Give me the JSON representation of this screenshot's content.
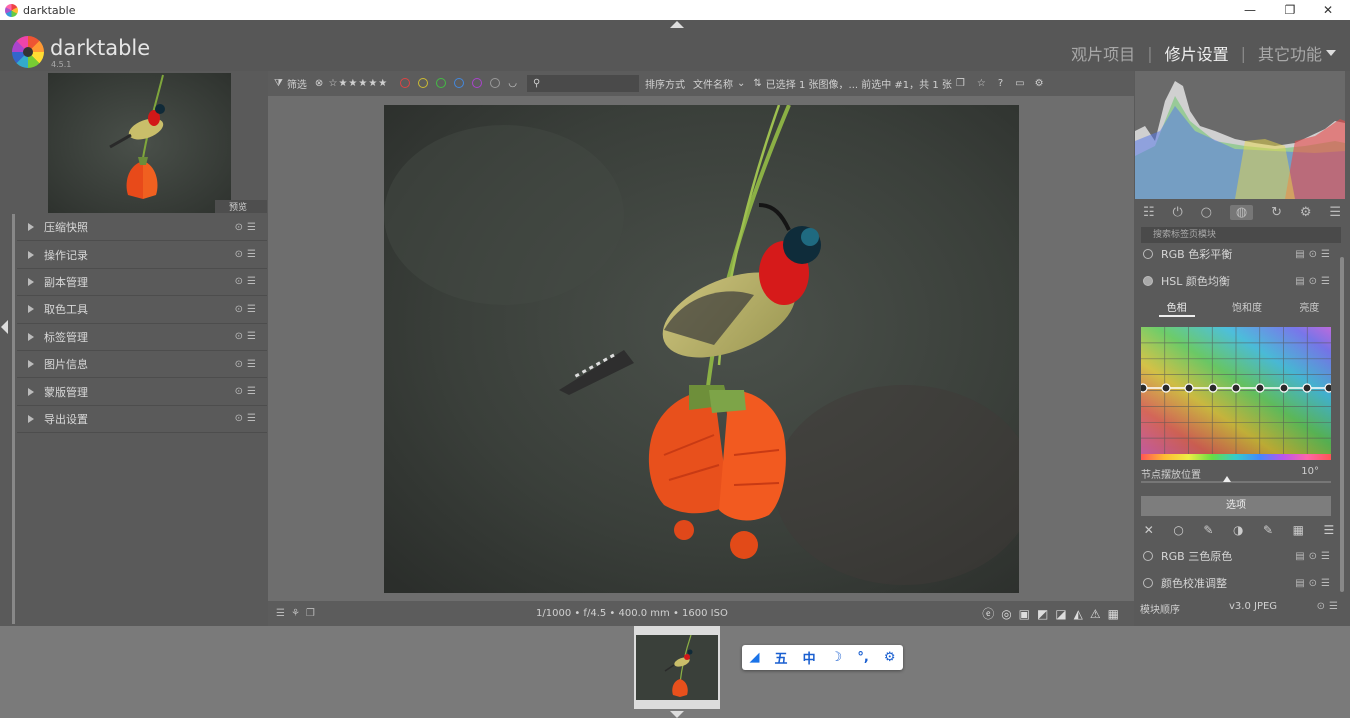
{
  "window": {
    "title": "darktable",
    "minimize": "—",
    "maximize": "❐",
    "close": "✕"
  },
  "header": {
    "app_name": "darktable",
    "version": "4.5.1",
    "views": [
      {
        "label": "观片项目",
        "active": false
      },
      {
        "label": "修片设置",
        "active": true
      },
      {
        "label": "其它功能",
        "active": false
      }
    ]
  },
  "left": {
    "navigation_label": "预览",
    "modules": [
      "压缩快照",
      "操作记录",
      "副本管理",
      "取色工具",
      "标签管理",
      "图片信息",
      "蒙版管理",
      "导出设置"
    ]
  },
  "filter_bar": {
    "filter_label": "筛选",
    "rating": "⊗ ☆★★★★★",
    "color_labels": [
      "#d44",
      "#cb3",
      "#4b4",
      "#48d",
      "#a4c"
    ],
    "sort_label": "排序方式",
    "sort_value": "文件名称",
    "selection_info": "已选择 1 张图像，... 前选中 #1，共 1 张"
  },
  "info_bar": {
    "exif": "1/1000 • f/4.5 • 400.0 mm • 1600 ISO"
  },
  "right": {
    "search_placeholder": "搜索标签页模块",
    "modules_top": [
      "RGB 色彩平衡",
      "HSL 颜色均衡"
    ],
    "subtabs": [
      "色相",
      "饱和度",
      "亮度"
    ],
    "hue_label": "节点摆放位置",
    "hue_value": "10°",
    "select_button": "选项",
    "modules_bottom": [
      "RGB 三色原色",
      "颜色校准调整"
    ],
    "footer_left": "模块顺序",
    "footer_right": "v3.0 JPEG"
  },
  "ime": {
    "items": [
      "五",
      "中"
    ]
  }
}
